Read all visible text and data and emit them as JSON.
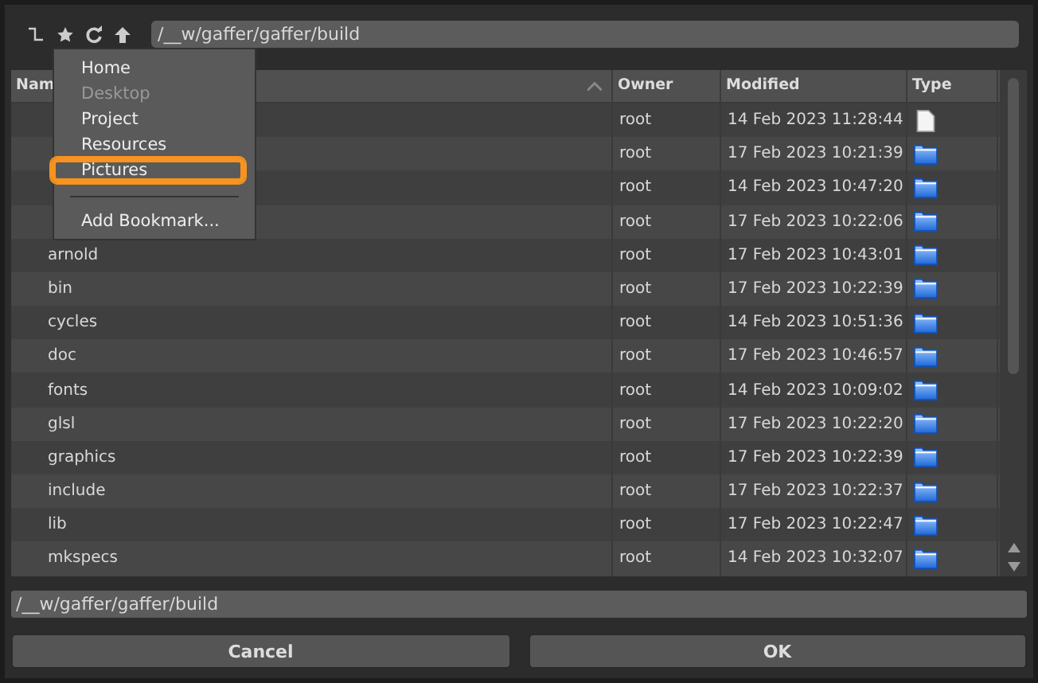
{
  "toolbar": {
    "path": "/__w/gaffer/gaffer/build"
  },
  "table": {
    "columns": [
      {
        "label": "Nam",
        "sorted": true
      },
      {
        "label": "Owner",
        "sorted": false
      },
      {
        "label": "Modified",
        "sorted": false
      },
      {
        "label": "Type",
        "sorted": false
      }
    ],
    "rows": [
      {
        "name": "",
        "owner": "root",
        "modified": "14 Feb 2023 11:28:44",
        "kind": "file"
      },
      {
        "name": "",
        "owner": "root",
        "modified": "17 Feb 2023 10:21:39",
        "kind": "folder"
      },
      {
        "name": "",
        "owner": "root",
        "modified": "14 Feb 2023 10:47:20",
        "kind": "folder"
      },
      {
        "name": "",
        "owner": "root",
        "modified": "17 Feb 2023 10:22:06",
        "kind": "folder"
      },
      {
        "name": "arnold",
        "owner": "root",
        "modified": "17 Feb 2023 10:43:01",
        "kind": "folder"
      },
      {
        "name": "bin",
        "owner": "root",
        "modified": "17 Feb 2023 10:22:39",
        "kind": "folder"
      },
      {
        "name": "cycles",
        "owner": "root",
        "modified": "14 Feb 2023 10:51:36",
        "kind": "folder"
      },
      {
        "name": "doc",
        "owner": "root",
        "modified": "17 Feb 2023 10:46:57",
        "kind": "folder"
      },
      {
        "name": "fonts",
        "owner": "root",
        "modified": "14 Feb 2023 10:09:02",
        "kind": "folder"
      },
      {
        "name": "glsl",
        "owner": "root",
        "modified": "17 Feb 2023 10:22:20",
        "kind": "folder"
      },
      {
        "name": "graphics",
        "owner": "root",
        "modified": "17 Feb 2023 10:22:39",
        "kind": "folder"
      },
      {
        "name": "include",
        "owner": "root",
        "modified": "17 Feb 2023 10:22:37",
        "kind": "folder"
      },
      {
        "name": "lib",
        "owner": "root",
        "modified": "17 Feb 2023 10:22:47",
        "kind": "folder"
      },
      {
        "name": "mkspecs",
        "owner": "root",
        "modified": "14 Feb 2023 10:32:07",
        "kind": "folder"
      }
    ]
  },
  "bookmarks_menu": {
    "items": [
      {
        "label": "Home",
        "disabled": false,
        "highlighted": false
      },
      {
        "label": "Desktop",
        "disabled": true,
        "highlighted": false
      },
      {
        "label": "Project",
        "disabled": false,
        "highlighted": false
      },
      {
        "label": "Resources",
        "disabled": false,
        "highlighted": false
      },
      {
        "label": "Pictures",
        "disabled": false,
        "highlighted": true
      }
    ],
    "action": "Add Bookmark..."
  },
  "path_field": {
    "value": "/__w/gaffer/gaffer/build"
  },
  "buttons": [
    "Cancel",
    "OK"
  ]
}
